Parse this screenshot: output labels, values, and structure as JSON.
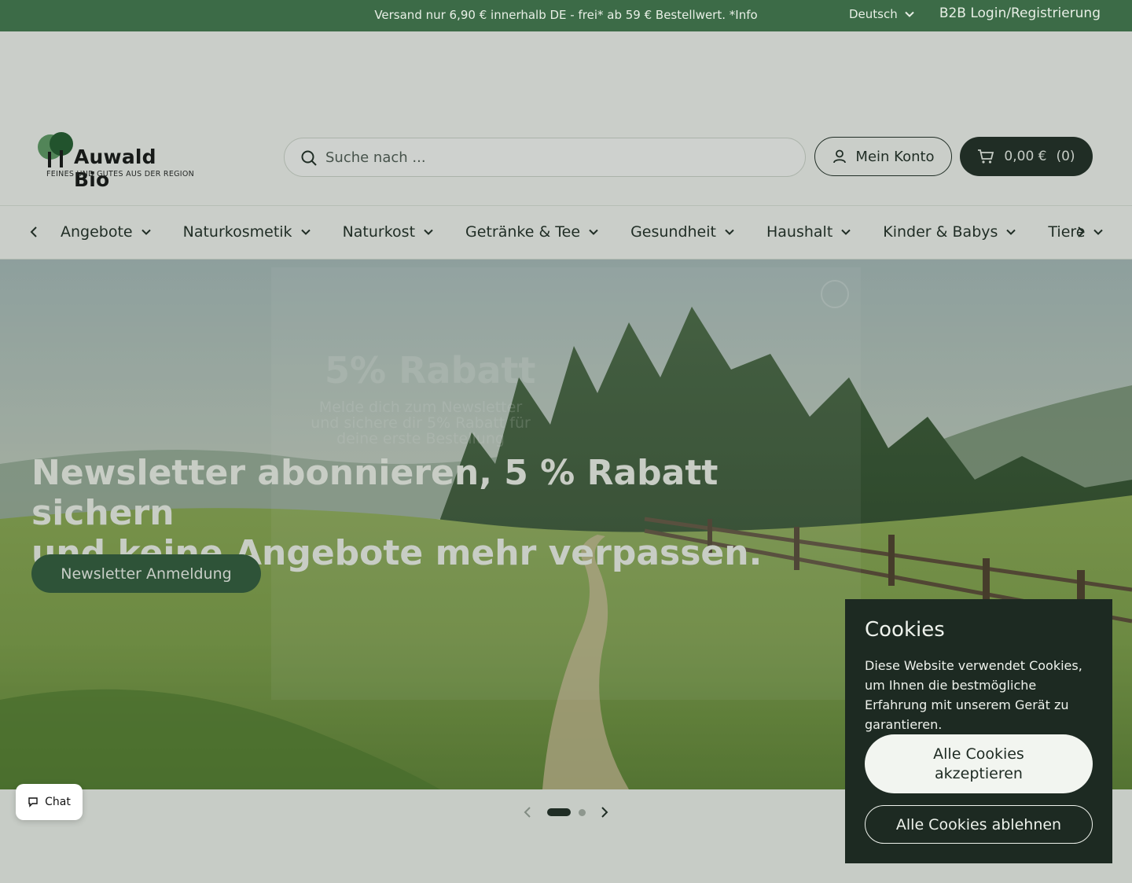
{
  "topbar": {
    "announcement": "Versand nur 6,90 € innerhalb DE -  frei* ab 59 € Bestellwert. *Info",
    "language": "Deutsch",
    "b2b": "B2B Login/Registrierung"
  },
  "header": {
    "logo_name": "Auwald Bio",
    "logo_tagline": "FEINES UND GUTES AUS DER REGION",
    "search_placeholder": "Suche nach ...",
    "account_label": "Mein Konto",
    "cart_total": "0,00 €",
    "cart_count": "(0)"
  },
  "nav": {
    "items": [
      {
        "label": "Angebote"
      },
      {
        "label": "Naturkosmetik"
      },
      {
        "label": "Naturkost"
      },
      {
        "label": "Getränke & Tee"
      },
      {
        "label": "Gesundheit"
      },
      {
        "label": "Haushalt"
      },
      {
        "label": "Kinder & Babys"
      },
      {
        "label": "Tiere"
      }
    ]
  },
  "hero": {
    "headline_line1": "Newsletter abonnieren, 5 % Rabatt sichern",
    "headline_line2": "und keine Angebote mehr verpassen.",
    "cta_label": "Newsletter Anmeldung",
    "popup_title": "5% Rabatt",
    "popup_text": "Melde dich zum Newsletter und sichere dir 5% Rabatt für deine erste Bestellung"
  },
  "slider": {
    "active_slide": 1,
    "slide_count": 2
  },
  "chat": {
    "label": "Chat"
  },
  "cookies": {
    "title": "Cookies",
    "text": "Diese Website verwendet Cookies, um Ihnen die bestmögliche Erfahrung mit unserem Gerät zu garantieren.",
    "accept_label": "Alle Cookies akzeptieren",
    "reject_label": "Alle Cookies ablehnen"
  },
  "colors": {
    "brand_green": "#3c6b47",
    "dark": "#1d2a22",
    "cta_green": "#2f5a3a"
  },
  "icons": [
    "chevron-down-icon",
    "user-icon",
    "cart-icon",
    "search-icon",
    "chevron-left-icon",
    "chevron-right-icon",
    "chat-icon",
    "close-icon",
    "tree-logo-icon"
  ]
}
